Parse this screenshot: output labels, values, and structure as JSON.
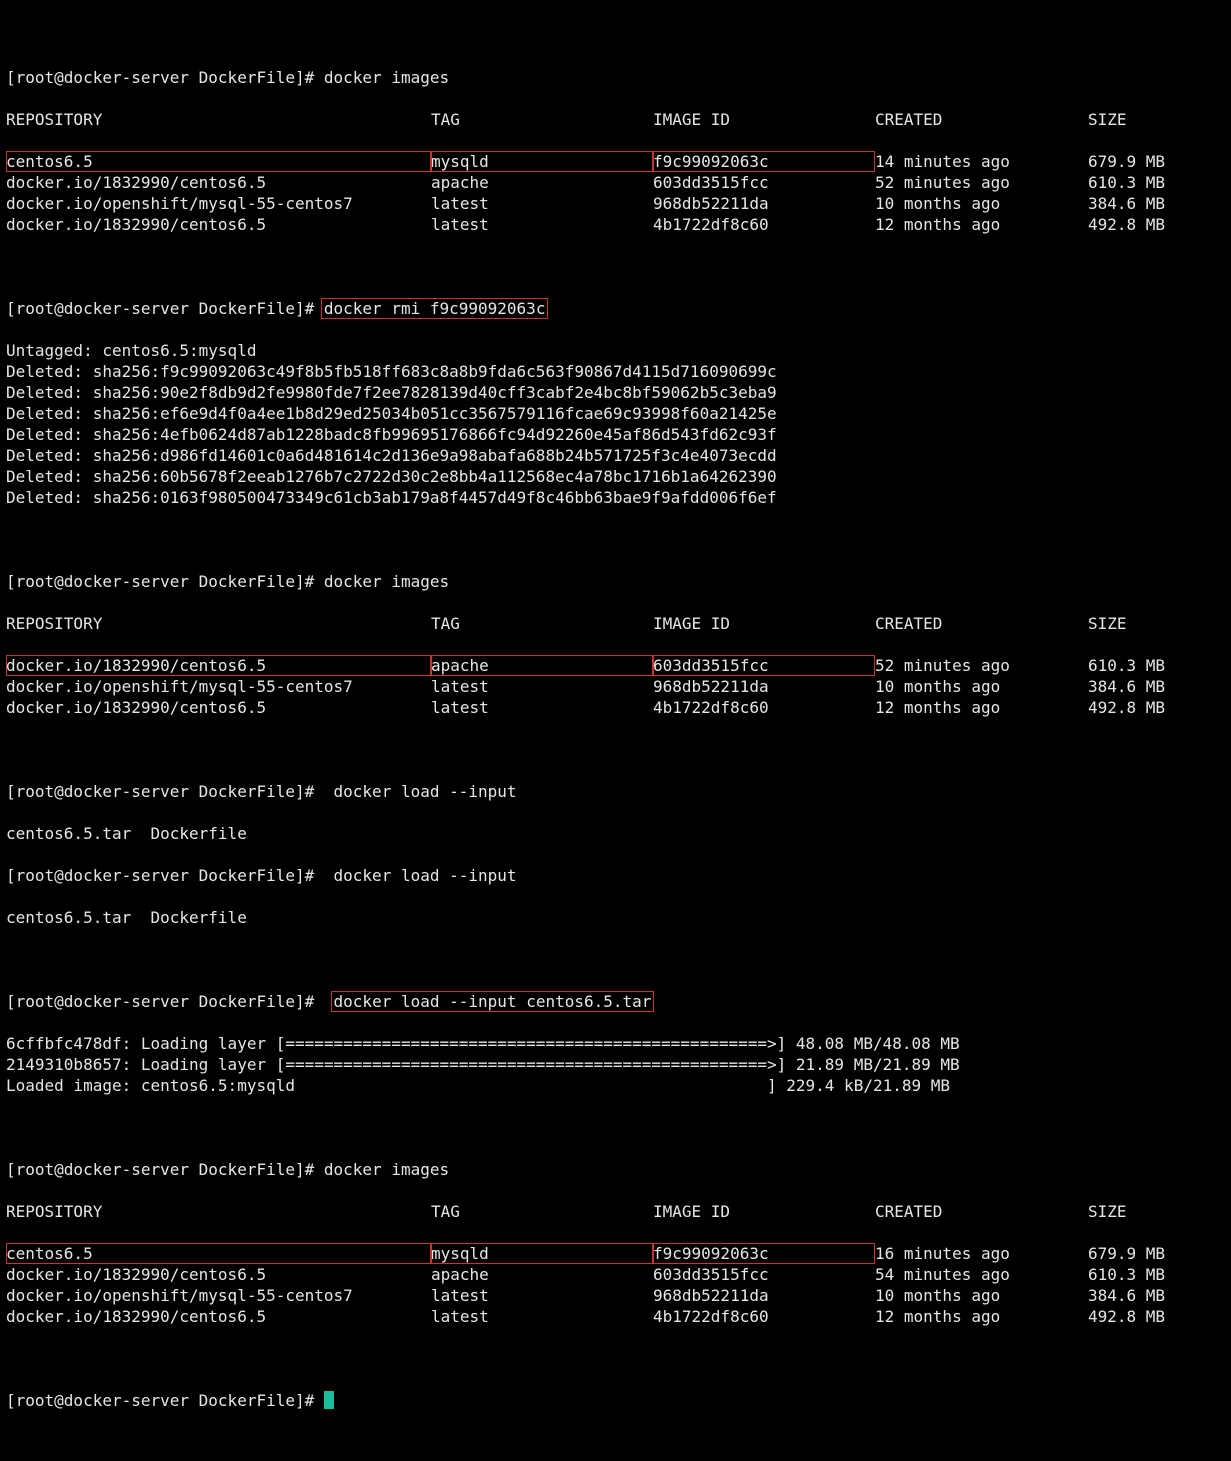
{
  "prompt": "[root@docker-server DockerFile]# ",
  "cmd_images": "docker images",
  "headers": {
    "repo": "REPOSITORY",
    "tag": "TAG",
    "image_id": "IMAGE ID",
    "created": "CREATED",
    "size": "SIZE"
  },
  "images1": [
    {
      "repo": "centos6.5",
      "tag": "mysqld",
      "id": "f9c99092063c",
      "created": "14 minutes ago",
      "size": "679.9 MB",
      "hl": true
    },
    {
      "repo": "docker.io/1832990/centos6.5",
      "tag": "apache",
      "id": "603dd3515fcc",
      "created": "52 minutes ago",
      "size": "610.3 MB",
      "hl": false
    },
    {
      "repo": "docker.io/openshift/mysql-55-centos7",
      "tag": "latest",
      "id": "968db52211da",
      "created": "10 months ago",
      "size": "384.6 MB",
      "hl": false
    },
    {
      "repo": "docker.io/1832990/centos6.5",
      "tag": "latest",
      "id": "4b1722df8c60",
      "created": "12 months ago",
      "size": "492.8 MB",
      "hl": false
    }
  ],
  "cmd_rmi": "docker rmi f9c99092063c",
  "rmi_output": [
    "Untagged: centos6.5:mysqld",
    "Deleted: sha256:f9c99092063c49f8b5fb518ff683c8a8b9fda6c563f90867d4115d716090699c",
    "Deleted: sha256:90e2f8db9d2fe9980fde7f2ee7828139d40cff3cabf2e4bc8bf59062b5c3eba9",
    "Deleted: sha256:ef6e9d4f0a4ee1b8d29ed25034b051cc3567579116fcae69c93998f60a21425e",
    "Deleted: sha256:4efb0624d87ab1228badc8fb99695176866fc94d92260e45af86d543fd62c93f",
    "Deleted: sha256:d986fd14601c0a6d481614c2d136e9a98abafa688b24b571725f3c4e4073ecdd",
    "Deleted: sha256:60b5678f2eeab1276b7c2722d30c2e8bb4a112568ec4a78bc1716b1a64262390",
    "Deleted: sha256:0163f980500473349c61cb3ab179a8f4457d49f8c46bb63bae9f9afdd006f6ef"
  ],
  "images2": [
    {
      "repo": "docker.io/1832990/centos6.5",
      "tag": "apache",
      "id": "603dd3515fcc",
      "created": "52 minutes ago",
      "size": "610.3 MB",
      "hl": true
    },
    {
      "repo": "docker.io/openshift/mysql-55-centos7",
      "tag": "latest",
      "id": "968db52211da",
      "created": "10 months ago",
      "size": "384.6 MB",
      "hl": false
    },
    {
      "repo": "docker.io/1832990/centos6.5",
      "tag": "latest",
      "id": "4b1722df8c60",
      "created": "12 months ago",
      "size": "492.8 MB",
      "hl": false
    }
  ],
  "cmd_load_partial": " docker load --input",
  "tab_completion": "centos6.5.tar  Dockerfile",
  "cmd_load_full": "docker load --input centos6.5.tar",
  "load_output": [
    "6cffbfc478df: Loading layer [==================================================>] 48.08 MB/48.08 MB",
    "2149310b8657: Loading layer [==================================================>] 21.89 MB/21.89 MB",
    "Loaded image: centos6.5:mysqld                                                 ] 229.4 kB/21.89 MB"
  ],
  "images3": [
    {
      "repo": "centos6.5",
      "tag": "mysqld",
      "id": "f9c99092063c",
      "created": "16 minutes ago",
      "size": "679.9 MB",
      "hl": true
    },
    {
      "repo": "docker.io/1832990/centos6.5",
      "tag": "apache",
      "id": "603dd3515fcc",
      "created": "54 minutes ago",
      "size": "610.3 MB",
      "hl": false
    },
    {
      "repo": "docker.io/openshift/mysql-55-centos7",
      "tag": "latest",
      "id": "968db52211da",
      "created": "10 months ago",
      "size": "384.6 MB",
      "hl": false
    },
    {
      "repo": "docker.io/1832990/centos6.5",
      "tag": "latest",
      "id": "4b1722df8c60",
      "created": "12 months ago",
      "size": "492.8 MB",
      "hl": false
    }
  ]
}
